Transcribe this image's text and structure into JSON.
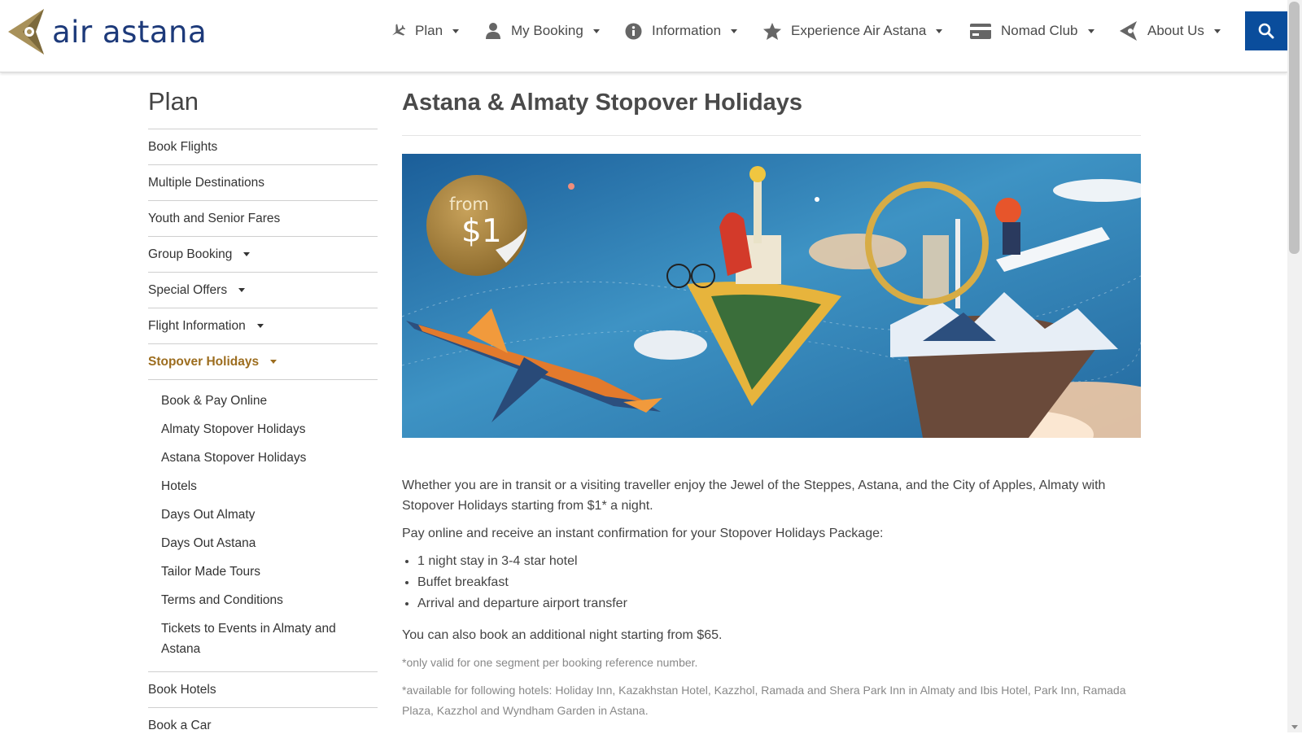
{
  "brand": {
    "name": "air astana",
    "colors": {
      "primary": "#1d3a7a",
      "gold": "#9c6d1f",
      "search": "#0a4d9c"
    }
  },
  "nav": {
    "items": [
      {
        "label": "Plan",
        "icon": "plane-icon"
      },
      {
        "label": "My Booking",
        "icon": "user-icon"
      },
      {
        "label": "Information",
        "icon": "info-icon"
      },
      {
        "label": "Experience Air Astana",
        "icon": "star-icon"
      },
      {
        "label": "Nomad Club",
        "icon": "card-icon"
      },
      {
        "label": "About Us",
        "icon": "logo-mark-icon"
      }
    ],
    "search_icon": "search-icon"
  },
  "sidebar": {
    "title": "Plan",
    "items": [
      {
        "label": "Book Flights"
      },
      {
        "label": "Multiple Destinations"
      },
      {
        "label": "Youth and Senior Fares"
      },
      {
        "label": "Group Booking",
        "has_dropdown": true
      },
      {
        "label": "Special Offers",
        "has_dropdown": true
      },
      {
        "label": "Flight Information",
        "has_dropdown": true
      },
      {
        "label": "Stopover Holidays",
        "has_dropdown": true,
        "active": true
      }
    ],
    "sub_items": [
      "Book & Pay Online",
      "Almaty Stopover Holidays",
      "Astana Stopover Holidays",
      "Hotels",
      "Days Out Almaty",
      "Days Out Astana",
      "Tailor Made Tours",
      "Terms and Conditions",
      "Tickets to Events in Almaty and Astana"
    ],
    "after_items": [
      {
        "label": "Book Hotels"
      },
      {
        "label": "Book a Car"
      }
    ]
  },
  "main": {
    "title": "Astana & Almaty Stopover Holidays",
    "hero": {
      "from_label": "from",
      "price": "$1"
    },
    "intro": "Whether you are in transit or a visiting traveller enjoy the Jewel of the Steppes, Astana, and the City of Apples, Almaty with Stopover Holidays starting from $1* a night.",
    "package_intro": "Pay online and receive an instant confirmation for your Stopover Holidays Package:",
    "package_items": [
      "1 night stay in 3-4 star hotel",
      "Buffet breakfast",
      "Arrival and departure airport transfer"
    ],
    "additional": "You can also book an additional night starting from $65.",
    "notes": [
      "*only valid for one segment per booking reference number.",
      "*available for following hotels: Holiday Inn, Kazakhstan Hotel, Kazzhol, Ramada and Shera Park Inn in Almaty and Ibis Hotel, Park Inn, Ramada Plaza, Kazzhol and Wyndham Garden in Astana."
    ]
  }
}
